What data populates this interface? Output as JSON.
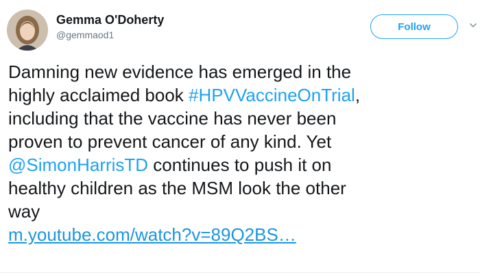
{
  "author": {
    "display_name": "Gemma O'Doherty",
    "handle": "@gemmaod1"
  },
  "follow_label": "Follow",
  "icons": {
    "caret": "chevron-down-icon",
    "avatar": "profile-photo"
  },
  "colors": {
    "link": "#1da1f2",
    "text": "#14171a",
    "muted": "#657786"
  },
  "tweet": {
    "line1": "Damning new evidence has emerged in the",
    "line2_pre": "highly acclaimed book ",
    "hashtag": "#HPVVaccineOnTrial",
    "line2_post": ",",
    "line3": "including that the vaccine has never been",
    "line4": "proven to prevent cancer of any kind. Yet",
    "mention": "@SimonHarrisTD",
    "line5_post": " continues to push it on",
    "line6": "healthy children as the MSM look the other",
    "line7": "way",
    "url": "m.youtube.com/watch?v=89Q2BS…"
  }
}
